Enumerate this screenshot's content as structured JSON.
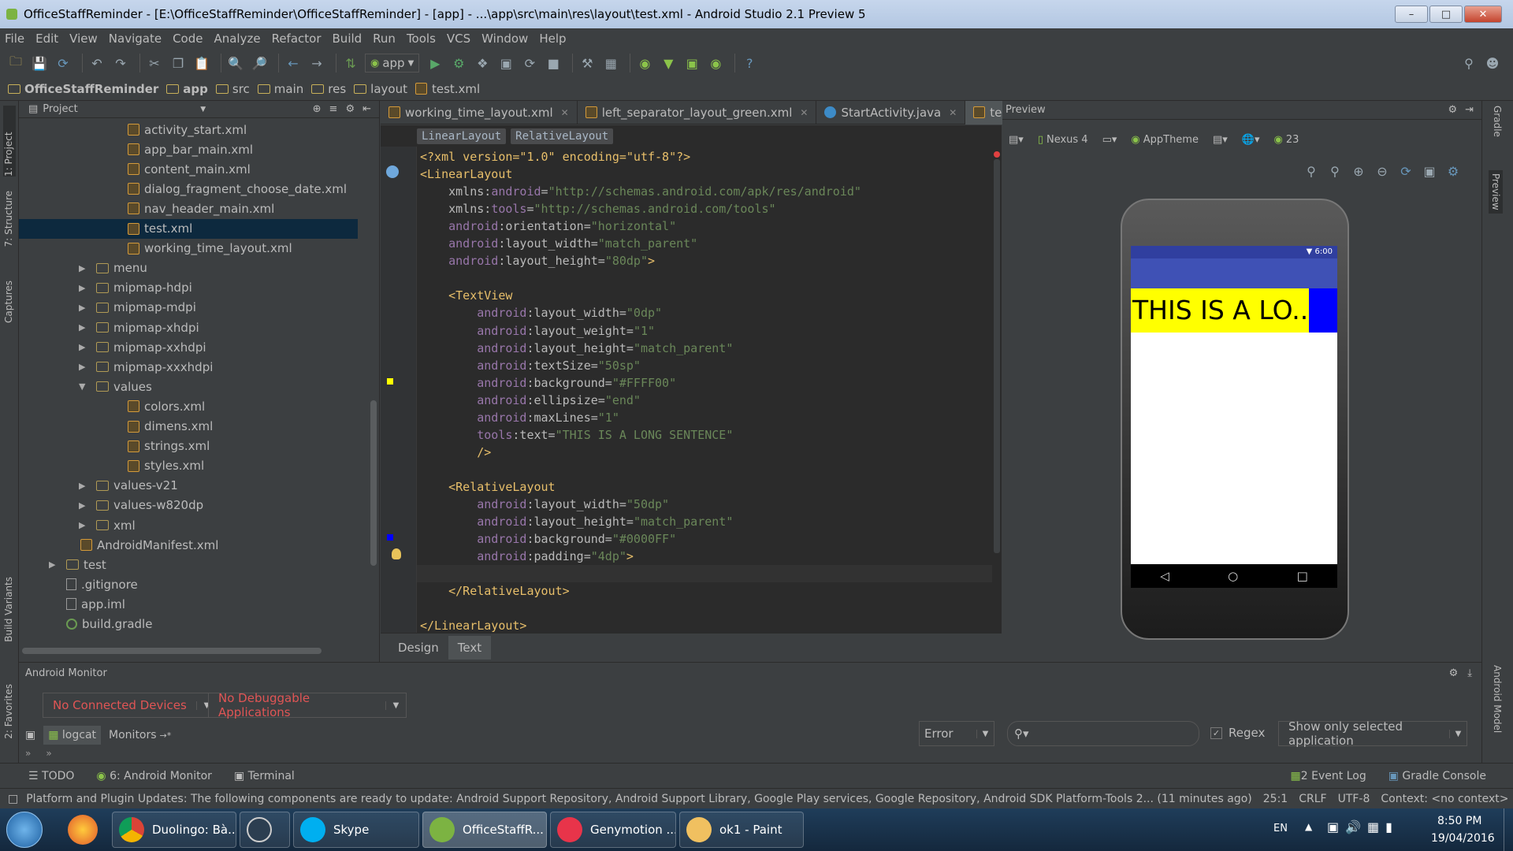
{
  "window": {
    "title": "OfficeStaffReminder - [E:\\OfficeStaffReminder\\OfficeStaffReminder] - [app] - ...\\app\\src\\main\\res\\layout\\test.xml - Android Studio 2.1 Preview 5"
  },
  "menu": [
    "File",
    "Edit",
    "View",
    "Navigate",
    "Code",
    "Analyze",
    "Refactor",
    "Build",
    "Run",
    "Tools",
    "VCS",
    "Window",
    "Help"
  ],
  "toolbar": {
    "run_config": "app"
  },
  "breadcrumb": [
    "OfficeStaffReminder",
    "app",
    "src",
    "main",
    "res",
    "layout",
    "test.xml"
  ],
  "project": {
    "header": "Project",
    "selected": "test.xml",
    "tree": [
      {
        "label": "activity_start.xml",
        "type": "xml",
        "depth": 3
      },
      {
        "label": "app_bar_main.xml",
        "type": "xml",
        "depth": 3
      },
      {
        "label": "content_main.xml",
        "type": "xml",
        "depth": 3
      },
      {
        "label": "dialog_fragment_choose_date.xml",
        "type": "xml",
        "depth": 3
      },
      {
        "label": "nav_header_main.xml",
        "type": "xml",
        "depth": 3
      },
      {
        "label": "test.xml",
        "type": "xml",
        "depth": 3
      },
      {
        "label": "working_time_layout.xml",
        "type": "xml",
        "depth": 3
      },
      {
        "label": "menu",
        "type": "folder",
        "depth": 2
      },
      {
        "label": "mipmap-hdpi",
        "type": "folder",
        "depth": 2
      },
      {
        "label": "mipmap-mdpi",
        "type": "folder",
        "depth": 2
      },
      {
        "label": "mipmap-xhdpi",
        "type": "folder",
        "depth": 2
      },
      {
        "label": "mipmap-xxhdpi",
        "type": "folder",
        "depth": 2
      },
      {
        "label": "mipmap-xxxhdpi",
        "type": "folder",
        "depth": 2
      },
      {
        "label": "values",
        "type": "open",
        "depth": 2
      },
      {
        "label": "colors.xml",
        "type": "xml",
        "depth": 3
      },
      {
        "label": "dimens.xml",
        "type": "xml",
        "depth": 3
      },
      {
        "label": "strings.xml",
        "type": "xml",
        "depth": 3
      },
      {
        "label": "styles.xml",
        "type": "xml",
        "depth": 3
      },
      {
        "label": "values-v21",
        "type": "folder",
        "depth": 2
      },
      {
        "label": "values-w820dp",
        "type": "folder",
        "depth": 2
      },
      {
        "label": "xml",
        "type": "folder",
        "depth": 2
      },
      {
        "label": "AndroidManifest.xml",
        "type": "xml",
        "depth": 1
      },
      {
        "label": "test",
        "type": "folder",
        "depth": 0
      },
      {
        "label": ".gitignore",
        "type": "file",
        "depth": -1
      },
      {
        "label": "app.iml",
        "type": "file",
        "depth": -1
      },
      {
        "label": "build.gradle",
        "type": "gradle",
        "depth": -1
      }
    ]
  },
  "editor": {
    "tabs": [
      {
        "label": "working_time_layout.xml",
        "active": false
      },
      {
        "label": "left_separator_layout_green.xml",
        "active": false
      },
      {
        "label": "StartActivity.java",
        "active": false
      },
      {
        "label": "test.xml",
        "active": true
      }
    ],
    "crumbs": [
      "LinearLayout",
      "RelativeLayout"
    ],
    "lines": [
      [
        [
          "pi",
          "<?xml version=\"1.0\" encoding=\"utf-8\"?>"
        ]
      ],
      [
        [
          "tg",
          "<LinearLayout"
        ]
      ],
      [
        [
          "pl",
          "    xmlns:"
        ],
        [
          "ns",
          "android"
        ],
        [
          "pl",
          "="
        ],
        [
          "av",
          "\"http://schemas.android.com/apk/res/android\""
        ]
      ],
      [
        [
          "pl",
          "    xmlns:"
        ],
        [
          "ns",
          "tools"
        ],
        [
          "pl",
          "="
        ],
        [
          "av",
          "\"http://schemas.android.com/tools\""
        ]
      ],
      [
        [
          "ns",
          "    android"
        ],
        [
          "at",
          ":orientation="
        ],
        [
          "av",
          "\"horizontal\""
        ]
      ],
      [
        [
          "ns",
          "    android"
        ],
        [
          "at",
          ":layout_width="
        ],
        [
          "av",
          "\"match_parent\""
        ]
      ],
      [
        [
          "ns",
          "    android"
        ],
        [
          "at",
          ":layout_height="
        ],
        [
          "av",
          "\"80dp\""
        ],
        [
          "tg",
          ">"
        ]
      ],
      [],
      [
        [
          "tg",
          "    <TextView"
        ]
      ],
      [
        [
          "ns",
          "        android"
        ],
        [
          "at",
          ":layout_width="
        ],
        [
          "av",
          "\"0dp\""
        ]
      ],
      [
        [
          "ns",
          "        android"
        ],
        [
          "at",
          ":layout_weight="
        ],
        [
          "av",
          "\"1\""
        ]
      ],
      [
        [
          "ns",
          "        android"
        ],
        [
          "at",
          ":layout_height="
        ],
        [
          "av",
          "\"match_parent\""
        ]
      ],
      [
        [
          "ns",
          "        android"
        ],
        [
          "at",
          ":textSize="
        ],
        [
          "av",
          "\"50sp\""
        ]
      ],
      [
        [
          "ns",
          "        android"
        ],
        [
          "at",
          ":background="
        ],
        [
          "av",
          "\"#FFFF00\""
        ]
      ],
      [
        [
          "ns",
          "        android"
        ],
        [
          "at",
          ":ellipsize="
        ],
        [
          "av",
          "\"end\""
        ]
      ],
      [
        [
          "ns",
          "        android"
        ],
        [
          "at",
          ":maxLines="
        ],
        [
          "av",
          "\"1\""
        ]
      ],
      [
        [
          "ns",
          "        tools"
        ],
        [
          "at",
          ":text="
        ],
        [
          "av",
          "\"THIS IS A LONG SENTENCE\""
        ]
      ],
      [
        [
          "tg",
          "        />"
        ]
      ],
      [],
      [
        [
          "tg",
          "    <RelativeLayout"
        ]
      ],
      [
        [
          "ns",
          "        android"
        ],
        [
          "at",
          ":layout_width="
        ],
        [
          "av",
          "\"50dp\""
        ]
      ],
      [
        [
          "ns",
          "        android"
        ],
        [
          "at",
          ":layout_height="
        ],
        [
          "av",
          "\"match_parent\""
        ]
      ],
      [
        [
          "ns",
          "        android"
        ],
        [
          "at",
          ":background="
        ],
        [
          "av",
          "\"#0000FF\""
        ]
      ],
      [
        [
          "ns",
          "        android"
        ],
        [
          "at",
          ":padding="
        ],
        [
          "av",
          "\"4dp\""
        ],
        [
          "tg",
          ">"
        ]
      ],
      [],
      [
        [
          "tg",
          "    </RelativeLayout>"
        ]
      ],
      [],
      [
        [
          "tg",
          "</LinearLayout>"
        ]
      ]
    ],
    "bottom_tabs": [
      "Design",
      "Text"
    ],
    "active_bottom_tab": "Text"
  },
  "preview": {
    "title": "Preview",
    "device": "Nexus 4",
    "theme": "AppTheme",
    "api": "23",
    "status_time": "6:00",
    "rendered_text": "THIS IS A LO...",
    "colors": {
      "yellow": "#FFFF00",
      "blue": "#0000FF",
      "appbar": "#3F51B5"
    }
  },
  "monitor": {
    "title": "Android Monitor",
    "devices": "No Connected Devices",
    "apps": "No Debuggable Applications",
    "tabs": [
      "logcat",
      "Monitors"
    ],
    "level": "Error",
    "search_placeholder": "",
    "regex_label": "Regex",
    "regex_checked": true,
    "filter": "Show only selected application"
  },
  "tooltabs": {
    "left": [
      "TODO",
      "6: Android Monitor",
      "Terminal"
    ],
    "right": [
      "2 Event Log",
      "Gradle Console"
    ]
  },
  "status": {
    "message": "Platform and Plugin Updates: The following components are ready to update: Android Support Repository, Android Support Library, Google Play services, Google Repository, Android SDK Platform-Tools 2... (11 minutes ago)",
    "position": "25:1",
    "line_sep": "CRLF",
    "encoding": "UTF-8",
    "context": "Context: <no context>"
  },
  "side_tabs": {
    "left": [
      "1: Project",
      "7: Structure",
      "Captures",
      "Build Variants",
      "2: Favorites"
    ],
    "right": [
      "Gradle",
      "Preview",
      "Android Model"
    ]
  },
  "taskbar": {
    "items": [
      "Duolingo: Bà...",
      "",
      "Skype",
      "OfficeStaffR...",
      "Genymotion ...",
      "ok1 - Paint"
    ],
    "lang": "EN",
    "time": "8:50 PM",
    "date": "19/04/2016"
  }
}
